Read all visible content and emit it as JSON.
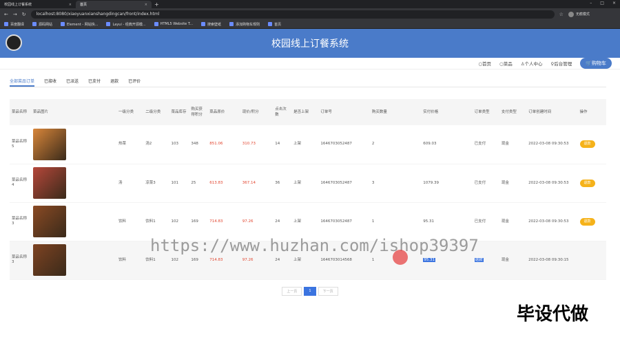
{
  "browser": {
    "tabs": [
      {
        "label": "校园线上订餐系统"
      },
      {
        "label": "首页"
      }
    ],
    "url": "localhost:8080/xiaoyuanxianshangdingcan/front/index.html",
    "profile": "无痕模式"
  },
  "bookmarks": [
    "百度翻译",
    "源码网站",
    "Element - 网站快...",
    "Layui - 经典开源模...",
    "HTML5 Website T...",
    "搜索壁纸",
    "添加购物车规则",
    "首页"
  ],
  "header": {
    "title": "校园线上订餐系统"
  },
  "nav": {
    "home": "首页",
    "dishes": "菜品",
    "profile": "个人中心",
    "admin": "后台管理",
    "cart": "购物车"
  },
  "subtabs": [
    "全部菜品订单",
    "已接收",
    "已派送",
    "已支付",
    "退款",
    "已评价"
  ],
  "table": {
    "headers": [
      "菜品名称",
      "菜品图片",
      "一级分类",
      "二级分类",
      "菜品库存",
      "购买获得积分",
      "菜品原价",
      "现价/积分",
      "点击次数",
      "是否上架",
      "订单号",
      "购买数量",
      "实付价格",
      "订单类型",
      "支付类型",
      "订单创建时间",
      "操作"
    ],
    "rows": [
      {
        "name": "菜品名称5",
        "cat1": "热菜",
        "cat2": "汤2",
        "stock": "103",
        "points": "348",
        "orig": "851.06",
        "now": "310.73",
        "clicks": "14",
        "shelf": "上架",
        "order": "1646703052487",
        "qty": "2",
        "paid": "609.03",
        "otype": "已支付",
        "ptype": "现金",
        "time": "2022-03-08 09:30:53",
        "op": "退款",
        "img": "#d8863a"
      },
      {
        "name": "菜品名称4",
        "cat1": "汤",
        "cat2": "凉菜3",
        "stock": "101",
        "points": "25",
        "orig": "613.83",
        "now": "367.14",
        "clicks": "36",
        "shelf": "上架",
        "order": "1646703052487",
        "qty": "3",
        "paid": "1079.39",
        "otype": "已支付",
        "ptype": "现金",
        "time": "2022-03-08 09:30:53",
        "op": "退款",
        "img": "#b5473a"
      },
      {
        "name": "菜品名称3",
        "cat1": "饮料",
        "cat2": "饮料1",
        "stock": "102",
        "points": "169",
        "orig": "714.83",
        "now": "97.26",
        "clicks": "24",
        "shelf": "上架",
        "order": "1646703052487",
        "qty": "1",
        "paid": "95.31",
        "otype": "已支付",
        "ptype": "现金",
        "time": "2022-03-08 09:30:53",
        "op": "退款",
        "img": "#8a4a24"
      },
      {
        "name": "菜品名称3",
        "cat1": "饮料",
        "cat2": "饮料1",
        "stock": "102",
        "points": "169",
        "orig": "714.83",
        "now": "97.26",
        "clicks": "24",
        "shelf": "上架",
        "order": "1646703014568",
        "qty": "1",
        "paid": "95.31",
        "otype": "退款",
        "ptype": "现金",
        "time": "2022-03-08 09:30:15",
        "op": "",
        "img": "#7e4322"
      }
    ]
  },
  "pager": {
    "prev": "上一页",
    "page": "1",
    "next": "下一页"
  },
  "overlay": {
    "watermark": "https://www.huzhan.com/ishop39397",
    "brand": "毕设代做"
  }
}
